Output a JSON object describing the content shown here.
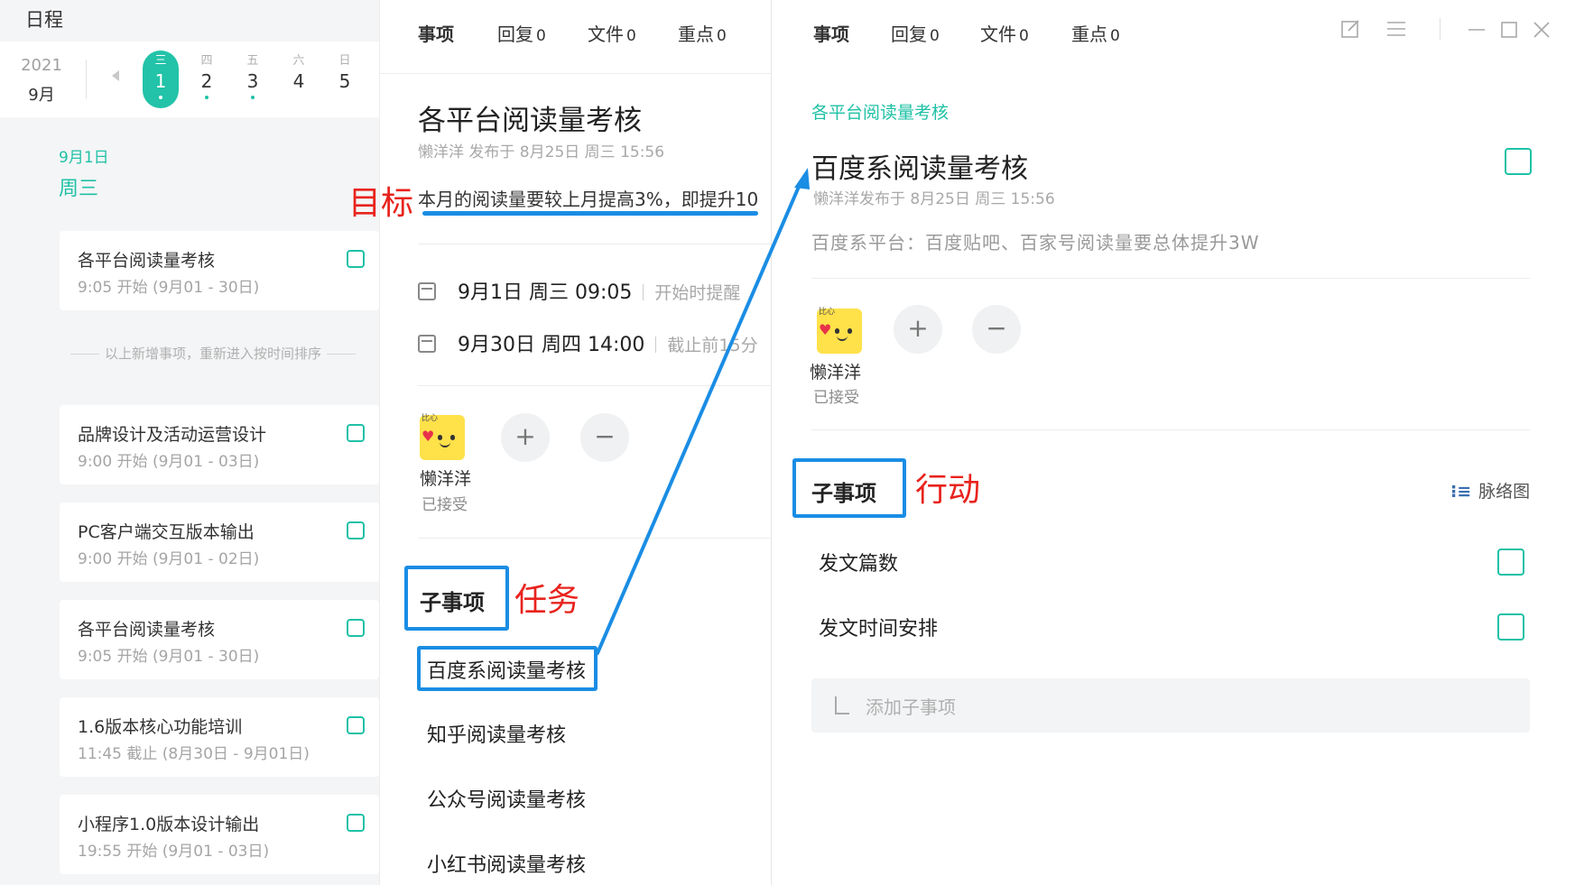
{
  "calendar": {
    "title": "日程",
    "year": "2021",
    "month": "9月",
    "days": [
      {
        "weekday": "三",
        "date": "1",
        "selected": true,
        "dot": true
      },
      {
        "weekday": "四",
        "date": "2",
        "selected": false,
        "dot": true
      },
      {
        "weekday": "五",
        "date": "3",
        "selected": false,
        "dot": true
      },
      {
        "weekday": "六",
        "date": "4",
        "selected": false,
        "dot": false
      },
      {
        "weekday": "日",
        "date": "5",
        "selected": false,
        "dot": false
      }
    ],
    "date_label": "9月1日",
    "weekday_label": "周三",
    "divider_note": "以上新增事项，重新进入按时间排序",
    "items": [
      {
        "title": "各平台阅读量考核",
        "sub": "9:05 开始 (9月01 - 30日)"
      },
      {
        "title": "品牌设计及活动运营设计",
        "sub": "9:00 开始 (9月01 - 03日)"
      },
      {
        "title": "PC客户端交互版本输出",
        "sub": "9:00 开始 (9月01 - 02日)"
      },
      {
        "title": "各平台阅读量考核",
        "sub": "9:05 开始 (9月01 - 30日)"
      },
      {
        "title": "1.6版本核心功能培训",
        "sub": "11:45 截止 (8月30日 - 9月01日)"
      },
      {
        "title": "小程序1.0版本设计输出",
        "sub": "19:55 开始 (9月01 - 03日)"
      }
    ]
  },
  "tabs": [
    {
      "label": "事项",
      "count": ""
    },
    {
      "label": "回复",
      "count": "0"
    },
    {
      "label": "文件",
      "count": "0"
    },
    {
      "label": "重点",
      "count": "0"
    }
  ],
  "middle": {
    "title": "各平台阅读量考核",
    "meta": "懒洋洋 发布于 8月25日 周三 15:56",
    "goal_text": "本月的阅读量要较上月提高3%，即提升10",
    "start_time": "9月1日 周三 09:05",
    "start_reminder": "开始时提醒",
    "end_time": "9月30日 周四 14:00",
    "end_reminder": "截止前15分",
    "member_name": "懒洋洋",
    "member_status": "已接受",
    "sub_heading": "子事项",
    "sub_items": [
      "百度系阅读量考核",
      "知乎阅读量考核",
      "公众号阅读量考核",
      "小红书阅读量考核"
    ]
  },
  "right": {
    "breadcrumb": "各平台阅读量考核",
    "title": "百度系阅读量考核",
    "meta": "懒洋洋发布于 8月25日 周三 15:56",
    "description": "百度系平台：百度贴吧、百家号阅读量要总体提升3W",
    "member_name": "懒洋洋",
    "member_status": "已接受",
    "sub_heading": "子事项",
    "mindmap_label": "脉络图",
    "sub_items": [
      "发文篇数",
      "发文时间安排"
    ],
    "add_sub_placeholder": "添加子事项"
  },
  "annotations": {
    "goal_label": "目标",
    "task_label": "任务",
    "action_label": "行动"
  },
  "colors": {
    "accent": "#1fc1a6",
    "annotation_red": "#e8231d",
    "annotation_blue": "#1a8de4"
  },
  "icons": {
    "edit": "edit-icon",
    "menu": "menu-icon",
    "minimize": "minimize-icon",
    "maximize": "maximize-icon",
    "close": "close-icon",
    "plus": "plus-icon",
    "minus": "minus-icon",
    "calendar": "calendar-icon",
    "mindmap": "mindmap-icon",
    "add_sub": "subtask-icon"
  }
}
